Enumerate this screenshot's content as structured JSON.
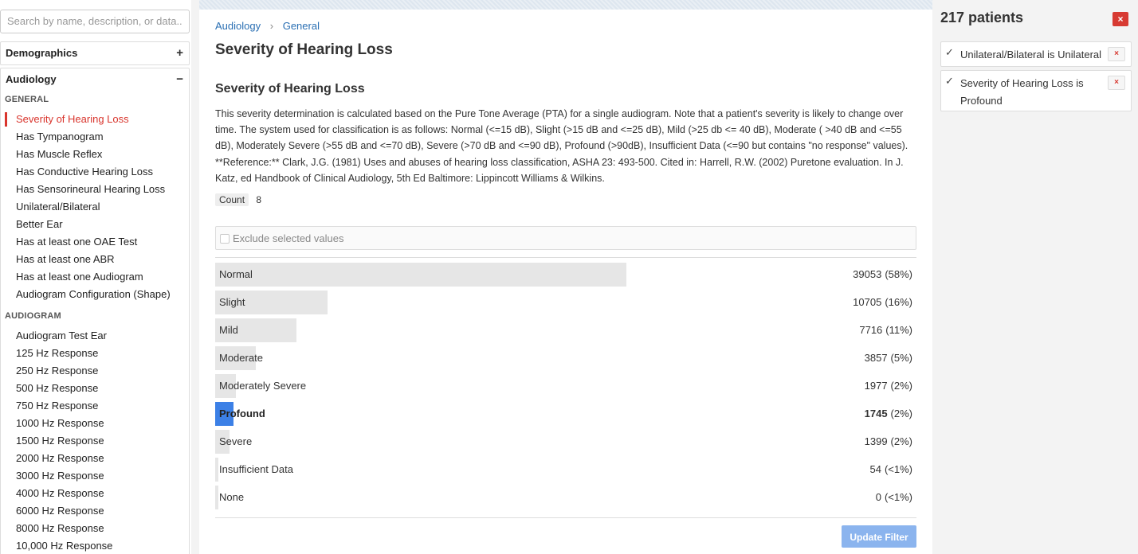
{
  "search": {
    "placeholder": "Search by name, description, or data.."
  },
  "sidebar": {
    "demographics": {
      "label": "Demographics",
      "toggle": "+"
    },
    "audiology": {
      "label": "Audiology",
      "toggle": "−",
      "general_label": "GENERAL",
      "general_items": [
        "Severity of Hearing Loss",
        "Has Tympanogram",
        "Has Muscle Reflex",
        "Has Conductive Hearing Loss",
        "Has Sensorineural Hearing Loss",
        "Unilateral/Bilateral",
        "Better Ear",
        "Has at least one OAE Test",
        "Has at least one ABR",
        "Has at least one Audiogram",
        "Audiogram Configuration (Shape)"
      ],
      "audiogram_label": "AUDIOGRAM",
      "audiogram_items": [
        "Audiogram Test Ear",
        "125 Hz Response",
        "250 Hz Response",
        "500 Hz Response",
        "750 Hz Response",
        "1000 Hz Response",
        "1500 Hz Response",
        "2000 Hz Response",
        "3000 Hz Response",
        "4000 Hz Response",
        "6000 Hz Response",
        "8000 Hz Response",
        "10,000 Hz Response"
      ]
    }
  },
  "main": {
    "breadcrumb": [
      "Audiology",
      "General"
    ],
    "breadcrumb_sep": "›",
    "title": "Severity of Hearing Loss",
    "section_title": "Severity of Hearing Loss",
    "description": "This severity determination is calculated based on the Pure Tone Average (PTA) for a single audiogram. Note that a patient's severity is likely to change over time. The system used for classification is as follows: Normal (<=15 dB), Slight (>15 dB and <=25 dB), Mild (>25 db <= 40 dB), Moderate ( >40 dB and <=55 dB), Moderately Severe (>55 dB and <=70 dB), Severe (>70 dB and <=90 dB), Profound (>90dB), Insufficient Data (<=90 but contains \"no response\" values). **Reference:** Clark, J.G. (1981) Uses and abuses of hearing loss classification, ASHA 23: 493-500. Cited in: Harrell, R.W. (2002) Puretone evaluation. In J. Katz, ed Handbook of Clinical Audiology, 5th Ed Baltimore: Lippincott Williams & Wilkins.",
    "count_label": "Count",
    "count_value": "8",
    "exclude_label": "Exclude selected values",
    "update_button": "Update Filter",
    "selected_color": "#3c80e6",
    "bars": [
      {
        "label": "Normal",
        "count": "39053",
        "pct": "(58%)",
        "fraction": 0.586,
        "selected": false
      },
      {
        "label": "Slight",
        "count": "10705",
        "pct": "(16%)",
        "fraction": 0.16,
        "selected": false
      },
      {
        "label": "Mild",
        "count": "7716",
        "pct": "(11%)",
        "fraction": 0.116,
        "selected": false
      },
      {
        "label": "Moderate",
        "count": "3857",
        "pct": "(5%)",
        "fraction": 0.058,
        "selected": false
      },
      {
        "label": "Moderately Severe",
        "count": "1977",
        "pct": "(2%)",
        "fraction": 0.03,
        "selected": false
      },
      {
        "label": "Profound",
        "count": "1745",
        "pct": "(2%)",
        "fraction": 0.026,
        "selected": true
      },
      {
        "label": "Severe",
        "count": "1399",
        "pct": "(2%)",
        "fraction": 0.021,
        "selected": false
      },
      {
        "label": "Insufficient Data",
        "count": "54",
        "pct": "(<1%)",
        "fraction": 0.004,
        "selected": false
      },
      {
        "label": "None",
        "count": "0",
        "pct": "(<1%)",
        "fraction": 0.004,
        "selected": false
      }
    ]
  },
  "right_panel": {
    "title": "217 patients",
    "close_icon": "×",
    "filters": [
      {
        "text": "Unilateral/Bilateral is Unilateral",
        "checked": "✓",
        "remove": "×"
      },
      {
        "text": "Severity of Hearing Loss is Profound",
        "checked": "✓",
        "remove": "×"
      }
    ]
  }
}
